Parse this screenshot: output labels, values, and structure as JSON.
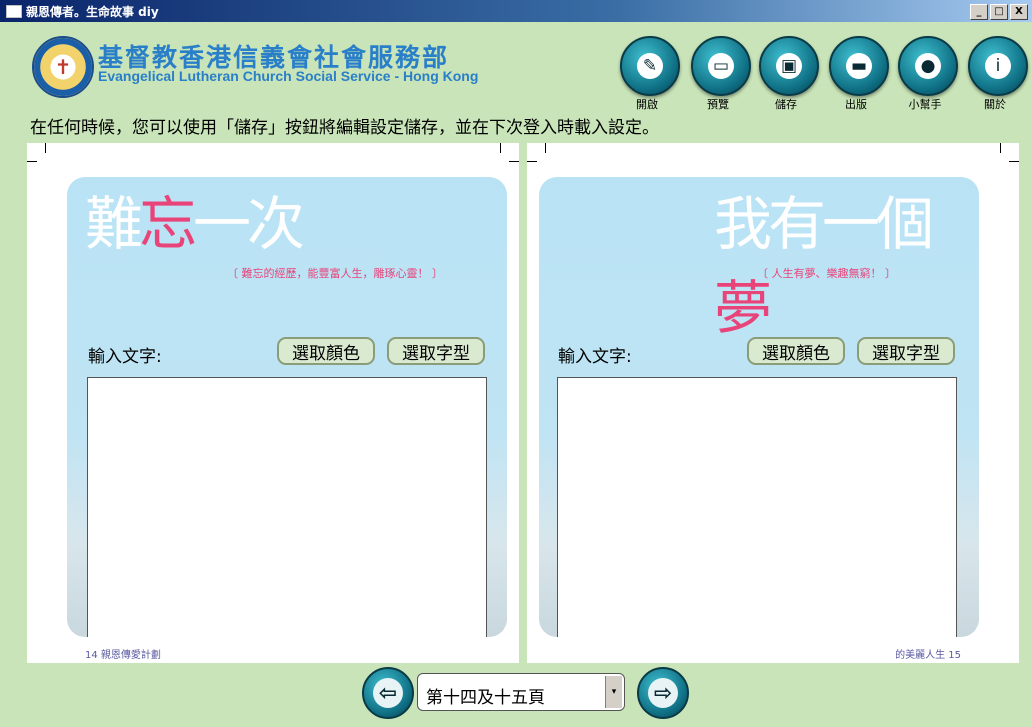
{
  "window": {
    "title": "親恩傳者。生命故事 diy",
    "minimize": "_",
    "maximize": "□",
    "close": "X"
  },
  "header": {
    "org_name_zh": "基督教香港信義會社會服務部",
    "org_name_en": "Evangelical Lutheran Church Social Service - Hong Kong",
    "toolbar": [
      {
        "label": "開啟",
        "icon": "pencil-icon",
        "glyph": "✎"
      },
      {
        "label": "預覽",
        "icon": "monitor-icon",
        "glyph": "▭"
      },
      {
        "label": "儲存",
        "icon": "floppy-disk-icon",
        "glyph": "▣"
      },
      {
        "label": "出版",
        "icon": "tray-icon",
        "glyph": "▬"
      },
      {
        "label": "小幫手",
        "icon": "helper-icon",
        "glyph": "●"
      },
      {
        "label": "關於",
        "icon": "info-icon",
        "glyph": "i"
      }
    ]
  },
  "instruction": "在任何時候，您可以使用「儲存」按鈕將編輯設定儲存，並在下次登入時載入設定。",
  "pages": [
    {
      "title_parts": [
        "難",
        "忘",
        "一次"
      ],
      "subtitle": "〔 難忘的經歷，能豐富人生，雕琢心靈！ 〕",
      "input_label": "輸入文字:",
      "color_button": "選取顏色",
      "font_button": "選取字型",
      "text_value": "",
      "folio": "14 親恩傳愛計劃"
    },
    {
      "title_parts": [
        "我有一個",
        "夢"
      ],
      "subtitle": "〔 人生有夢、樂趣無窮！ 〕",
      "input_label": "輸入文字:",
      "color_button": "選取顏色",
      "font_button": "選取字型",
      "text_value": "",
      "folio": "的美麗人生 15"
    }
  ],
  "navigation": {
    "prev_glyph": "⇦",
    "next_glyph": "⇨",
    "page_select_value": "第十四及十五頁",
    "dropdown_glyph": "▾"
  }
}
